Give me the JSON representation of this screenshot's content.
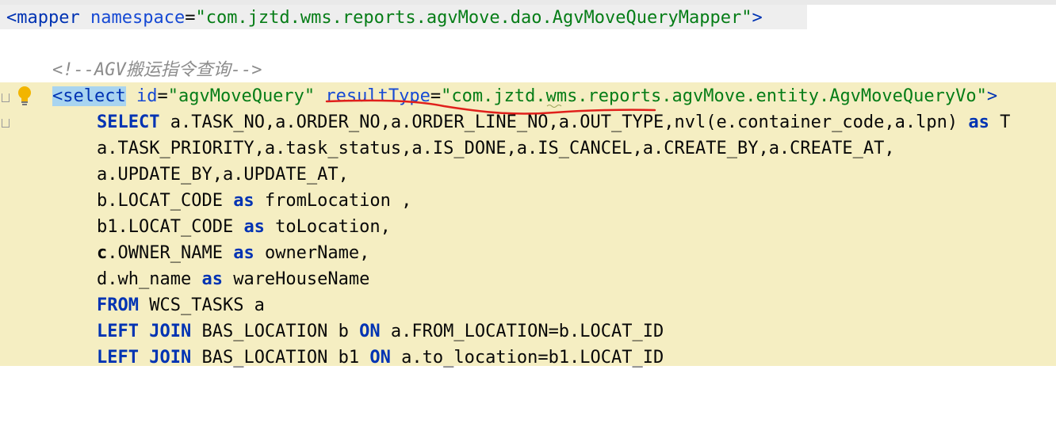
{
  "editor": {
    "mapper_line": {
      "open": "<",
      "tag": "mapper",
      "attr": "namespace",
      "eq": "=",
      "value": "\"com.jztd.wms.reports.agvMove.dao.AgvMoveQueryMapper\"",
      "close": ">"
    },
    "comment": "<!--AGV搬运指令查询-->",
    "select_line": {
      "open": "<",
      "tag": "select",
      "id_attr": "id",
      "id_value": "\"agvMoveQuery\"",
      "result_attr": "resultType",
      "result_value": "\"com.jztd.wms.reports.agvMove.entity.AgvMoveQueryVo\"",
      "close": ">"
    },
    "sql": {
      "l1_kw": "SELECT",
      "l1_text": " a.TASK_NO,a.ORDER_NO,a.ORDER_LINE_NO,a.OUT_TYPE,nvl(e.container_code,a.lpn) ",
      "l1_as": "as",
      "l1_tail": " T",
      "l2": "a.TASK_PRIORITY,a.task_status,a.IS_DONE,a.IS_CANCEL,a.CREATE_BY,a.CREATE_AT,",
      "l3": "a.UPDATE_BY,a.UPDATE_AT,",
      "l4_a": "b.LOCAT_CODE ",
      "l4_as": "as",
      "l4_b": " fromLocation ,",
      "l5_a": "b1.LOCAT_CODE ",
      "l5_as": "as",
      "l5_b": " toLocation,",
      "l6_bold": "c",
      "l6_a": ".OWNER_NAME ",
      "l6_as": "as",
      "l6_b": " ownerName,",
      "l7_a": "d.wh_name ",
      "l7_as": "as",
      "l7_b": " wareHouseName",
      "l8_kw": "FROM",
      "l8_b": " WCS_TASKS a",
      "l9_kw1": "LEFT JOIN",
      "l9_a": " BAS_LOCATION b ",
      "l9_kw2": "ON",
      "l9_b": " a.FROM_LOCATION=b.LOCAT_ID",
      "l10_kw1": "LEFT JOIN",
      "l10_a": " BAS_LOCATION b1 ",
      "l10_kw2": "ON",
      "l10_b": " a.to_location=b1.LOCAT_ID"
    },
    "colors": {
      "tag": "#0033b3",
      "string": "#067d17",
      "comment": "#8c8c8c",
      "selection_background": "#f5eec2",
      "annotation_red": "#e0201b"
    },
    "icons": [
      "lightbulb-icon",
      "fold-marker-icon"
    ]
  }
}
